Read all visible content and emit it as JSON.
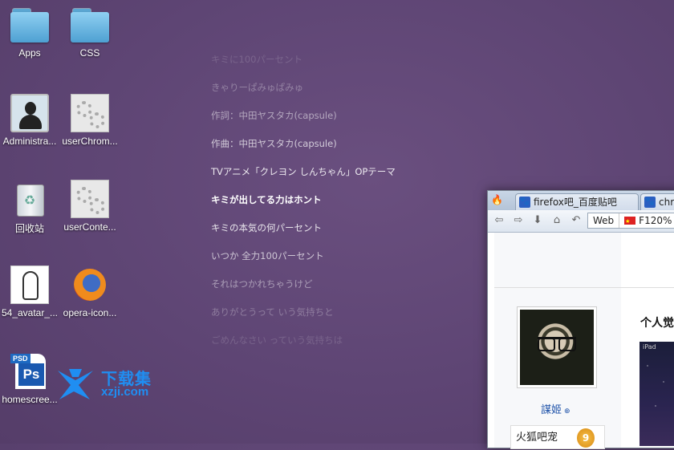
{
  "desktop": {
    "icons": [
      {
        "label": "Apps"
      },
      {
        "label": "CSS"
      },
      {
        "label": "Administra..."
      },
      {
        "label": "userChrom..."
      },
      {
        "label": "回收站"
      },
      {
        "label": "userConte..."
      },
      {
        "label": "54_avatar_..."
      },
      {
        "label": "opera-icon..."
      },
      {
        "label": "homescree..."
      }
    ]
  },
  "lyrics": {
    "lines": [
      {
        "text": "キミに100パーセント",
        "opacity": 0.15
      },
      {
        "text": "きゃりーぱみゅぱみゅ",
        "opacity": 0.3
      },
      {
        "text": "作詞：中田ヤスタカ(capsule)",
        "opacity": 0.5
      },
      {
        "text": "作曲：中田ヤスタカ(capsule)",
        "opacity": 0.7
      },
      {
        "text": "TVアニメ「クレヨン しんちゃん」OPテーマ",
        "opacity": 0.88
      },
      {
        "text": "キミが出してる力はホント",
        "opacity": 1.0,
        "bold": true
      },
      {
        "text": "キミの本気の何パーセント",
        "opacity": 0.85
      },
      {
        "text": "いつか 全力100パーセント",
        "opacity": 0.68
      },
      {
        "text": "それはつかれちゃうけど",
        "opacity": 0.45
      },
      {
        "text": "ありがとうって いう気持ちと",
        "opacity": 0.28
      },
      {
        "text": "ごめんなさい っていう気持ちは",
        "opacity": 0.15
      }
    ]
  },
  "watermark": {
    "title": "下载集",
    "domain": "xzji.com"
  },
  "browser": {
    "tabs": [
      {
        "label": "firefox吧_百度贴吧"
      },
      {
        "label": "chro"
      }
    ],
    "search_engine": "Web",
    "address": "F120%",
    "profile": {
      "username": "謀姬",
      "forum": "火狐吧宠",
      "level": "9"
    },
    "section_title": "个人觉",
    "photo_label": "iPad"
  }
}
